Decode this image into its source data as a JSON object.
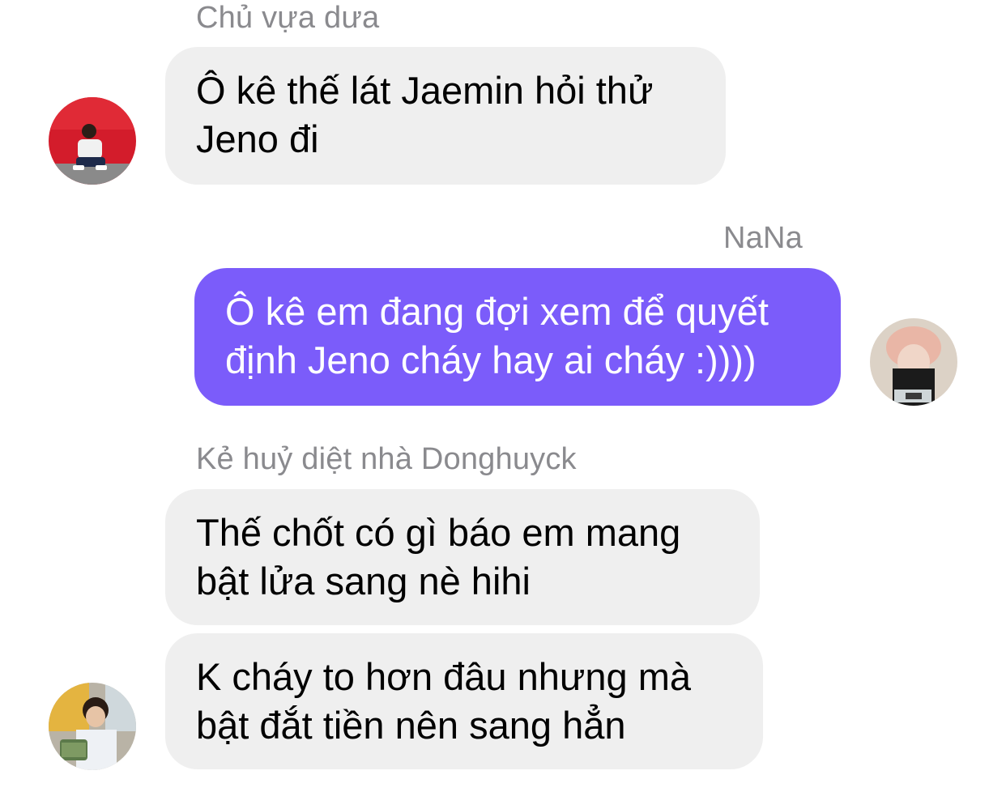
{
  "messages": [
    {
      "sender": "Chủ vựa dưa",
      "text": "Ô kê thế lát Jaemin hỏi thử\nJeno đi"
    },
    {
      "sender": "NaNa",
      "text": "Ô kê em đang đợi xem để quyết\nđịnh Jeno cháy hay ai cháy :))))"
    },
    {
      "sender": "Kẻ huỷ diệt nhà Donghuyck",
      "text": "Thế chốt có gì báo em mang\nbật lửa sang nè hihi"
    },
    {
      "sender": "",
      "text": "K cháy to hơn đâu nhưng mà\nbật đắt tiền nên sang hẳn"
    }
  ],
  "colors": {
    "outgoing_bubble": "#7b5cfa",
    "incoming_bubble": "#efefef",
    "sender_name": "#8a8a8e"
  }
}
